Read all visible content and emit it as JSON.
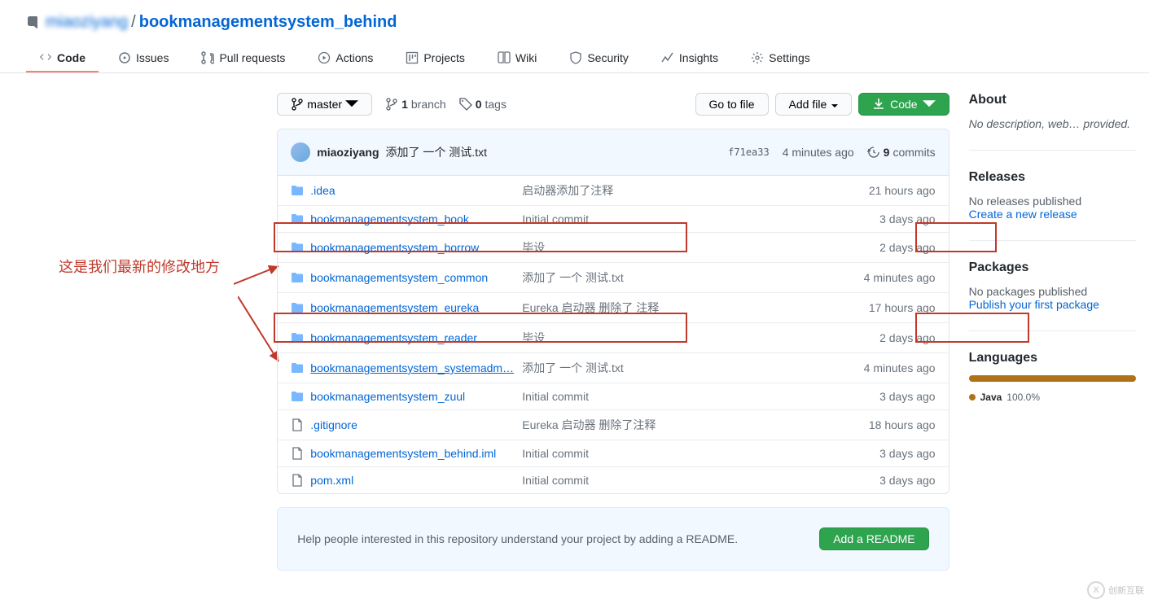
{
  "repo": {
    "owner": "miaoziyang",
    "name": "bookmanagementsystem_behind"
  },
  "tabs": {
    "code": "Code",
    "issues": "Issues",
    "pr": "Pull requests",
    "actions": "Actions",
    "projects": "Projects",
    "wiki": "Wiki",
    "security": "Security",
    "insights": "Insights",
    "settings": "Settings"
  },
  "fileNav": {
    "branchLabel": "master",
    "branchCount": "1",
    "branchWord": "branch",
    "tagCount": "0",
    "tagWord": "tags",
    "goToFile": "Go to file",
    "addFile": "Add file",
    "code": "Code"
  },
  "latestCommit": {
    "author": "miaoziyang",
    "message": "添加了 一个 测试.txt",
    "sha": "f71ea33",
    "time": "4 minutes ago",
    "commitsCount": "9",
    "commitsWord": "commits"
  },
  "files": [
    {
      "type": "dir",
      "name": ".idea",
      "msg": "启动器添加了注释",
      "time": "21 hours ago"
    },
    {
      "type": "dir",
      "name": "bookmanagementsystem_book",
      "msg": "Initial commit",
      "time": "3 days ago"
    },
    {
      "type": "dir",
      "name": "bookmanagementsystem_borrow",
      "msg": "毕设",
      "time": "2 days ago"
    },
    {
      "type": "dir",
      "name": "bookmanagementsystem_common",
      "msg": "添加了 一个 测试.txt",
      "time": "4 minutes ago"
    },
    {
      "type": "dir",
      "name": "bookmanagementsystem_eureka",
      "msg": "Eureka 启动器 删除了 注释",
      "time": "17 hours ago"
    },
    {
      "type": "dir",
      "name": "bookmanagementsystem_reader",
      "msg": "毕设",
      "time": "2 days ago"
    },
    {
      "type": "dir",
      "name": "bookmanagementsystem_systemadm…",
      "msg": "添加了 一个 测试.txt",
      "time": "4 minutes ago"
    },
    {
      "type": "dir",
      "name": "bookmanagementsystem_zuul",
      "msg": "Initial commit",
      "time": "3 days ago"
    },
    {
      "type": "file",
      "name": ".gitignore",
      "msg": "Eureka 启动器 删除了注释",
      "time": "18 hours ago"
    },
    {
      "type": "file",
      "name": "bookmanagementsystem_behind.iml",
      "msg": "Initial commit",
      "time": "3 days ago"
    },
    {
      "type": "file",
      "name": "pom.xml",
      "msg": "Initial commit",
      "time": "3 days ago"
    }
  ],
  "readmeHint": {
    "text": "Help people interested in this repository understand your project by adding a README.",
    "button": "Add a README"
  },
  "sidebar": {
    "about": {
      "title": "About",
      "desc": "No description, web… provided."
    },
    "releases": {
      "title": "Releases",
      "none": "No releases published",
      "link": "Create a new release"
    },
    "packages": {
      "title": "Packages",
      "none": "No packages published",
      "link": "Publish your first package"
    },
    "languages": {
      "title": "Languages",
      "lang": "Java",
      "pct": "100.0%"
    }
  },
  "annotation": {
    "text": "这是我们最新的修改地方"
  },
  "watermark": {
    "text": "创新互联"
  }
}
